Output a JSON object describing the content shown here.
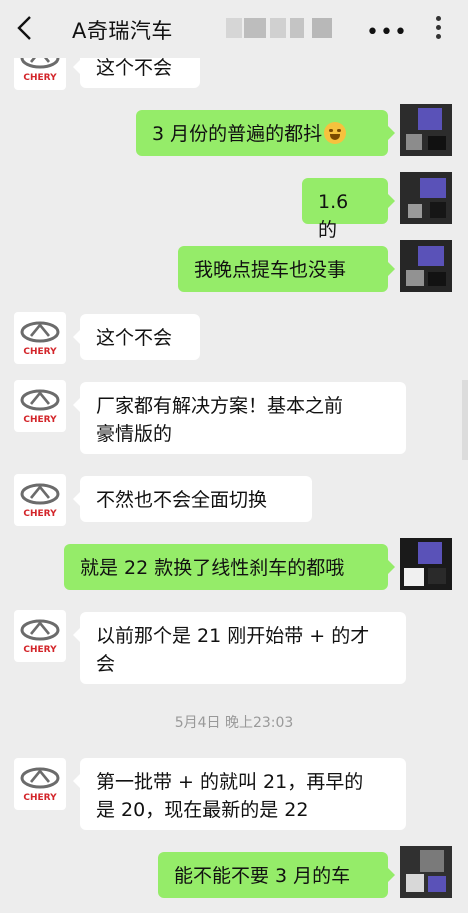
{
  "header": {
    "title": "A奇瑞汽车",
    "back_icon": "chevron-left-icon",
    "more_label": "•••",
    "more_icon": "more-icon"
  },
  "brand": {
    "logo_text": "CHERY",
    "logo_color": "#d3252a"
  },
  "timestamp": "5月4日 晚上23:03",
  "messages": [
    {
      "side": "in",
      "text": "这个不会"
    },
    {
      "side": "out",
      "text": "3 月份的普遍的都抖"
    },
    {
      "side": "out",
      "text": "1.6 的"
    },
    {
      "side": "out",
      "text": "我晚点提车也没事"
    },
    {
      "side": "in",
      "text": "这个不会"
    },
    {
      "side": "in",
      "lines": [
        "厂家都有解决方案！基本之前",
        "豪情版的"
      ]
    },
    {
      "side": "in",
      "text": "不然也不会全面切换"
    },
    {
      "side": "out",
      "text": "就是 22 款换了线性刹车的都哦"
    },
    {
      "side": "in",
      "lines": [
        "以前那个是 21 刚开始带 + 的才",
        "会"
      ]
    },
    {
      "side": "in",
      "lines": [
        "第一批带 + 的就叫 21，再早的",
        "是 20，现在最新的是 22"
      ]
    },
    {
      "side": "out",
      "text": "能不能不要 3 月的车"
    }
  ],
  "colors": {
    "incoming": "#ffffff",
    "outgoing": "#95ec69",
    "background": "#ededed"
  }
}
